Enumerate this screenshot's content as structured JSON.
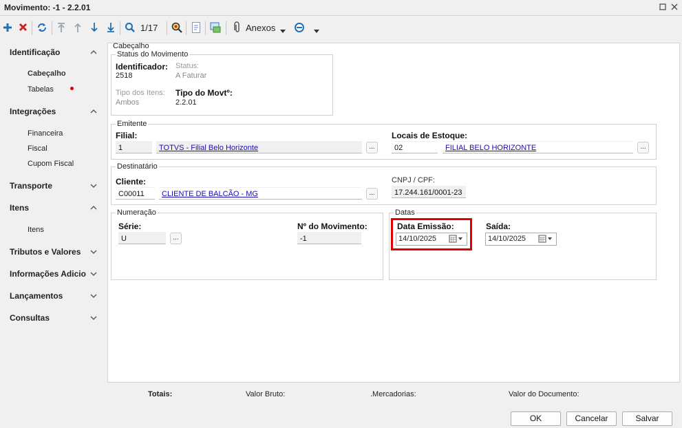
{
  "window": {
    "title": "Movimento: -1 - 2.2.01"
  },
  "toolbar": {
    "record_counter": "1/17",
    "anexos_label": "Anexos"
  },
  "sidebar": {
    "sections": [
      {
        "label": "Identificação",
        "items": [
          "Cabeçalho",
          "Tabelas"
        ]
      },
      {
        "label": "Integrações",
        "items": [
          "Financeira",
          "Fiscal",
          "Cupom Fiscal"
        ]
      },
      {
        "label": "Transporte",
        "items": []
      },
      {
        "label": "Itens",
        "items": [
          "Itens"
        ]
      },
      {
        "label": "Tributos e Valores",
        "items": []
      },
      {
        "label": "Informações Adicio",
        "items": []
      },
      {
        "label": "Lançamentos",
        "items": []
      },
      {
        "label": "Consultas",
        "items": []
      }
    ]
  },
  "main": {
    "caption": "Cabeçalho",
    "status": {
      "legend": "Status do Movimento",
      "identificador_label": "Identificador:",
      "identificador_value": "2518",
      "status_label": "Status:",
      "status_value": "A Faturar",
      "tipo_itens_label": "Tipo dos Itens:",
      "tipo_itens_value": "Ambos",
      "tipo_movto_label": "Tipo do Movtº:",
      "tipo_movto_value": "2.2.01"
    },
    "emitente": {
      "legend": "Emitente",
      "filial_label": "Filial:",
      "filial_code": "1",
      "filial_name": "TOTVS - Filial Belo Horizonte",
      "locais_label": "Locais de Estoque:",
      "locais_code": "02",
      "locais_name": "FILIAL BELO HORIZONTE"
    },
    "destinatario": {
      "legend": "Destinatário",
      "cliente_label": "Cliente:",
      "cliente_code": "C00011",
      "cliente_name": "CLIENTE DE BALCÃO - MG",
      "cnpj_label": "CNPJ / CPF:",
      "cnpj_value": "17.244.161/0001-23"
    },
    "numeracao": {
      "legend": "Numeração",
      "serie_label": "Série:",
      "serie_value": "U",
      "num_label": "Nº do Movimento:",
      "num_value": "-1"
    },
    "datas": {
      "legend": "Datas",
      "emissao_label": "Data Emissão:",
      "emissao_value": "14/10/2025",
      "saida_label": "Saída:",
      "saida_value": "14/10/2025"
    },
    "dots_label": "..."
  },
  "totals": {
    "totais_label": "Totais:",
    "valor_bruto_label": "Valor Bruto:",
    "mercadorias_label": ".Mercadorias:",
    "valor_documento_label": "Valor do Documento:"
  },
  "buttons": {
    "ok": "OK",
    "cancelar": "Cancelar",
    "salvar": "Salvar"
  },
  "colors": {
    "highlight": "#e00000",
    "accent_blue": "#1f6fb5",
    "delete_red": "#cc2222",
    "link": "#1a0dab"
  }
}
